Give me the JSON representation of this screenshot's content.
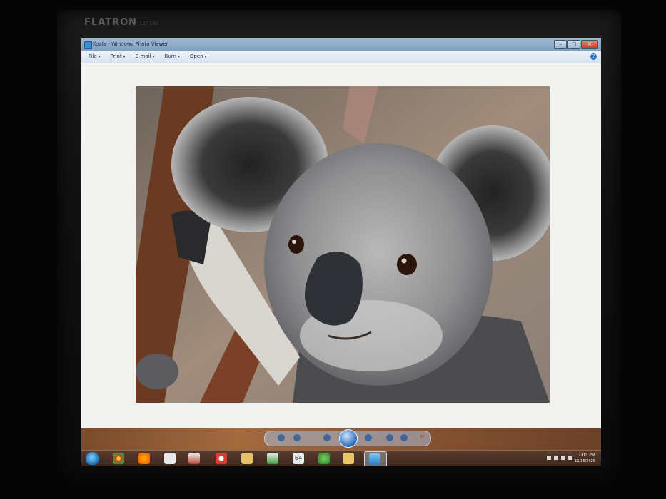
{
  "monitor": {
    "brand": "FLATRON",
    "model": "L1718S"
  },
  "window": {
    "title": "Koala - Windows Photo Viewer",
    "controls": {
      "minimize": "–",
      "maximize": "□",
      "close": "✕"
    }
  },
  "menu": {
    "items": [
      {
        "label": "File"
      },
      {
        "label": "Print"
      },
      {
        "label": "E-mail"
      },
      {
        "label": "Burn"
      },
      {
        "label": "Open"
      }
    ],
    "help": "?"
  },
  "photo": {
    "subject": "koala",
    "icon": "koala-photo"
  },
  "viewer_controls": {
    "icons": [
      "search-icon",
      "actual-size-icon",
      "previous-icon",
      "slideshow-play-icon",
      "next-icon",
      "rotate-left-icon",
      "rotate-right-icon",
      "delete-icon"
    ],
    "delete_glyph": "✕"
  },
  "taskbar": {
    "icons": [
      "start-orb-icon",
      "chrome-icon",
      "firefox-icon",
      "document-icon",
      "media-icon",
      "opera-icon",
      "app-icon",
      "store-icon",
      "calendar-64-icon",
      "app-green-icon",
      "folder-icon",
      "photo-viewer-icon"
    ],
    "calendar_label": "64",
    "clock": {
      "time": "7:03 PM",
      "date": "11/16/2025"
    }
  }
}
